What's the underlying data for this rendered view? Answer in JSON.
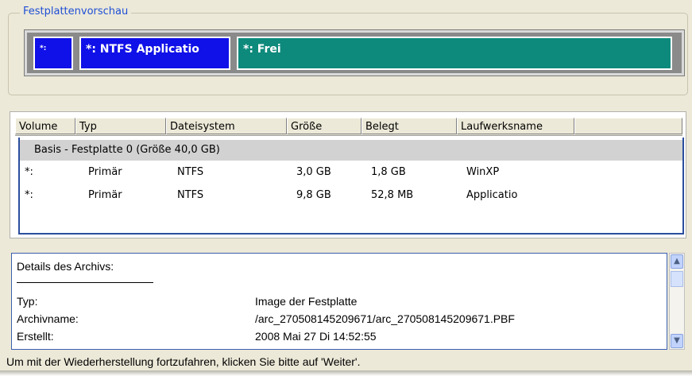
{
  "preview": {
    "title": "Festplattenvorschau",
    "partitions": [
      {
        "label": "*:",
        "color": "#1010e8"
      },
      {
        "label": "*: NTFS Applicatio",
        "color": "#1010e8"
      },
      {
        "label": "*: Frei",
        "color": "#0d8a7c"
      }
    ]
  },
  "table": {
    "columns": [
      "Volume",
      "Typ",
      "Dateisystem",
      "Größe",
      "Belegt",
      "Laufwerksname"
    ],
    "group_label": "Basis -  Festplatte 0 (Größe 40,0 GB)",
    "rows": [
      {
        "volume": "*:",
        "typ": "Primär",
        "fs": "NTFS",
        "size": "3,0 GB",
        "used": "1,8 GB",
        "name": "WinXP"
      },
      {
        "volume": "*:",
        "typ": "Primär",
        "fs": "NTFS",
        "size": "9,8 GB",
        "used": "52,8 MB",
        "name": "Applicatio"
      }
    ]
  },
  "details": {
    "heading": "Details des Archivs:",
    "fields": [
      {
        "label": "Typ:",
        "value": "Image der Festplatte"
      },
      {
        "label": "Archivname:",
        "value": "/arc_270508145209671/arc_270508145209671.PBF"
      },
      {
        "label": "Erstellt:",
        "value": "2008 Mai 27 Di 14:52:55"
      }
    ]
  },
  "status_text": "Um mit der Wiederherstellung fortzufahren, klicken Sie bitte auf 'Weiter'."
}
